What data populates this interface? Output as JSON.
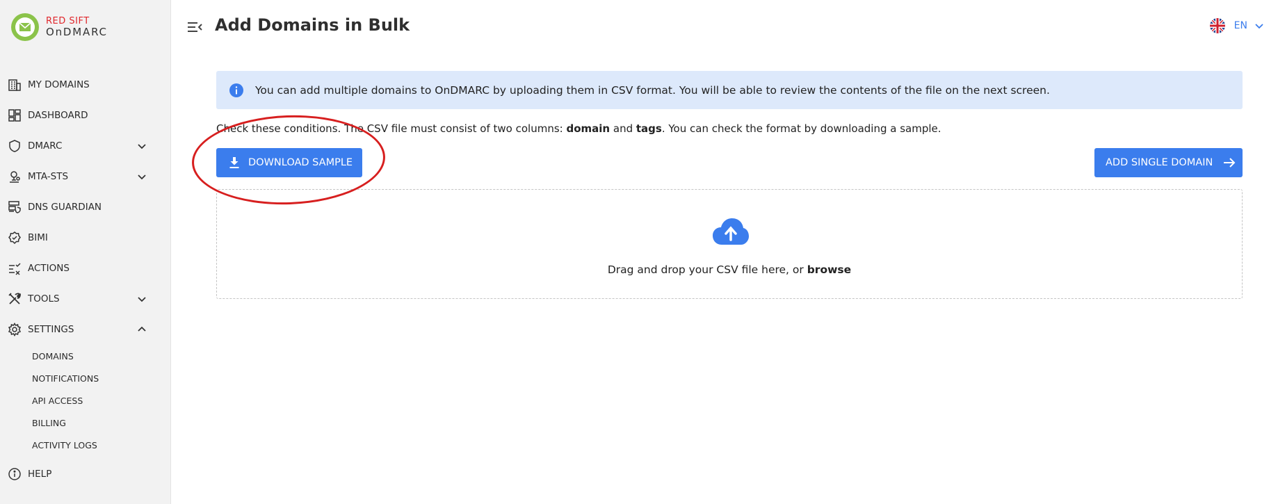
{
  "logo": {
    "top": "RED SIFT",
    "bottom": "OnDMARC"
  },
  "sidebar": {
    "items": [
      {
        "label": "MY DOMAINS",
        "icon": "building-icon"
      },
      {
        "label": "DASHBOARD",
        "icon": "dashboard-icon"
      },
      {
        "label": "DMARC",
        "icon": "shield-icon",
        "expandable": true,
        "expanded": false
      },
      {
        "label": "MTA-STS",
        "icon": "mta-sts-icon",
        "expandable": true,
        "expanded": false
      },
      {
        "label": "DNS GUARDIAN",
        "icon": "dns-guardian-icon"
      },
      {
        "label": "BIMI",
        "icon": "badge-check-icon"
      },
      {
        "label": "ACTIONS",
        "icon": "actions-list-icon"
      },
      {
        "label": "TOOLS",
        "icon": "tools-icon",
        "expandable": true,
        "expanded": false
      },
      {
        "label": "SETTINGS",
        "icon": "gear-icon",
        "expandable": true,
        "expanded": true
      }
    ],
    "settings_sub": [
      "DOMAINS",
      "NOTIFICATIONS",
      "API ACCESS",
      "BILLING",
      "ACTIVITY LOGS"
    ],
    "help": {
      "label": "HELP",
      "icon": "info-circle-icon"
    }
  },
  "header": {
    "title": "Add Domains in Bulk",
    "language": "EN"
  },
  "info": {
    "text": "You can add multiple domains to OnDMARC by uploading them in CSV format. You will be able to review the contents of the file on the next screen."
  },
  "conditions": {
    "prefix": "Check these conditions. The CSV file must consist of two columns: ",
    "col1": "domain",
    "and": " and ",
    "col2": "tags",
    "suffix": ". You can check the format by downloading a sample."
  },
  "buttons": {
    "download": "DOWNLOAD SAMPLE",
    "add_single": "ADD SINGLE DOMAIN"
  },
  "dropzone": {
    "text": "Drag and drop your CSV file here, or ",
    "browse": "browse"
  },
  "colors": {
    "accent": "#3b7ded",
    "info_bg": "#dde9fb",
    "sidebar_bg": "#f2f2f2",
    "annotation": "#d71f1f",
    "logo_red": "#e0262b",
    "logo_green": "#8bc34a"
  }
}
